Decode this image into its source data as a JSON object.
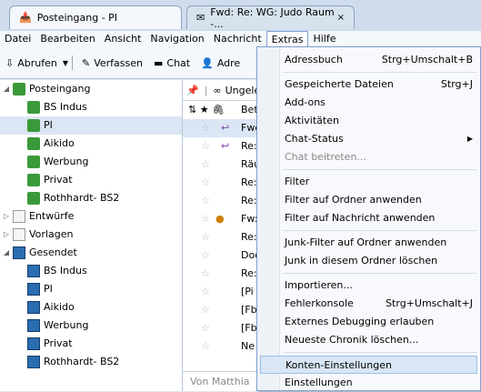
{
  "tabs": [
    {
      "title": "Posteingang - PI",
      "icon": "inbox-icon"
    },
    {
      "title": "Fwd: Re: WG: Judo Raum -...",
      "icon": "mail-icon",
      "close": "×"
    }
  ],
  "menubar": [
    "Datei",
    "Bearbeiten",
    "Ansicht",
    "Navigation",
    "Nachricht",
    "Extras",
    "Hilfe"
  ],
  "toolbar": {
    "fetch": "Abrufen",
    "compose": "Verfassen",
    "chat": "Chat",
    "address": "Adre"
  },
  "folders": [
    {
      "label": "Posteingang",
      "level": 0,
      "twisty": "◢",
      "icon": "inbox"
    },
    {
      "label": "BS Indus",
      "level": 1,
      "icon": "inbox"
    },
    {
      "label": "PI",
      "level": 1,
      "icon": "inbox",
      "selected": true
    },
    {
      "label": "Aikido",
      "level": 1,
      "icon": "inbox"
    },
    {
      "label": "Werbung",
      "level": 1,
      "icon": "inbox"
    },
    {
      "label": "Privat",
      "level": 1,
      "icon": "inbox"
    },
    {
      "label": "Rothhardt- BS2",
      "level": 1,
      "icon": "inbox"
    },
    {
      "label": "Entwürfe",
      "level": 0,
      "twisty": "▷",
      "icon": "doc"
    },
    {
      "label": "Vorlagen",
      "level": 0,
      "twisty": "▷",
      "icon": "doc"
    },
    {
      "label": "Gesendet",
      "level": 0,
      "twisty": "◢",
      "icon": "sent"
    },
    {
      "label": "BS Indus",
      "level": 1,
      "icon": "sent"
    },
    {
      "label": "PI",
      "level": 1,
      "icon": "sent"
    },
    {
      "label": "Aikido",
      "level": 1,
      "icon": "sent"
    },
    {
      "label": "Werbung",
      "level": 1,
      "icon": "sent"
    },
    {
      "label": "Privat",
      "level": 1,
      "icon": "sent"
    },
    {
      "label": "Rothhardt- BS2",
      "level": 1,
      "icon": "sent"
    }
  ],
  "msglist": {
    "filter": "Ungele",
    "rows": [
      {
        "subject": "Bet",
        "header": true
      },
      {
        "subject": "Fwd",
        "reply": true,
        "selected": true
      },
      {
        "subject": "Re:",
        "reply": true
      },
      {
        "subject": "Räu"
      },
      {
        "subject": "Re:"
      },
      {
        "subject": "Re:"
      },
      {
        "subject": "Fw:",
        "attach": true
      },
      {
        "subject": "Re:"
      },
      {
        "subject": "Doo"
      },
      {
        "subject": "Re:"
      },
      {
        "subject": "[Pi"
      },
      {
        "subject": "[Fb"
      },
      {
        "subject": "[Fb"
      },
      {
        "subject": "Ne"
      }
    ],
    "preview": "Von  Matthia"
  },
  "extras_menu": [
    {
      "label": "Adressbuch",
      "shortcut": "Strg+Umschalt+B"
    },
    {
      "sep": true
    },
    {
      "label": "Gespeicherte Dateien",
      "shortcut": "Strg+J"
    },
    {
      "label": "Add-ons"
    },
    {
      "label": "Aktivitäten"
    },
    {
      "label": "Chat-Status",
      "submenu": true
    },
    {
      "label": "Chat beitreten...",
      "disabled": true
    },
    {
      "sep": true
    },
    {
      "label": "Filter"
    },
    {
      "label": "Filter auf Ordner anwenden"
    },
    {
      "label": "Filter auf Nachricht anwenden"
    },
    {
      "sep": true
    },
    {
      "label": "Junk-Filter auf Ordner anwenden"
    },
    {
      "label": "Junk in diesem Ordner löschen"
    },
    {
      "sep": true
    },
    {
      "label": "Importieren..."
    },
    {
      "label": "Fehlerkonsole",
      "shortcut": "Strg+Umschalt+J"
    },
    {
      "label": "Externes Debugging erlauben"
    },
    {
      "label": "Neueste Chronik löschen..."
    },
    {
      "sep": true
    },
    {
      "label": "Konten-Einstellungen",
      "highlighted": true
    },
    {
      "label": "Einstellungen"
    }
  ]
}
